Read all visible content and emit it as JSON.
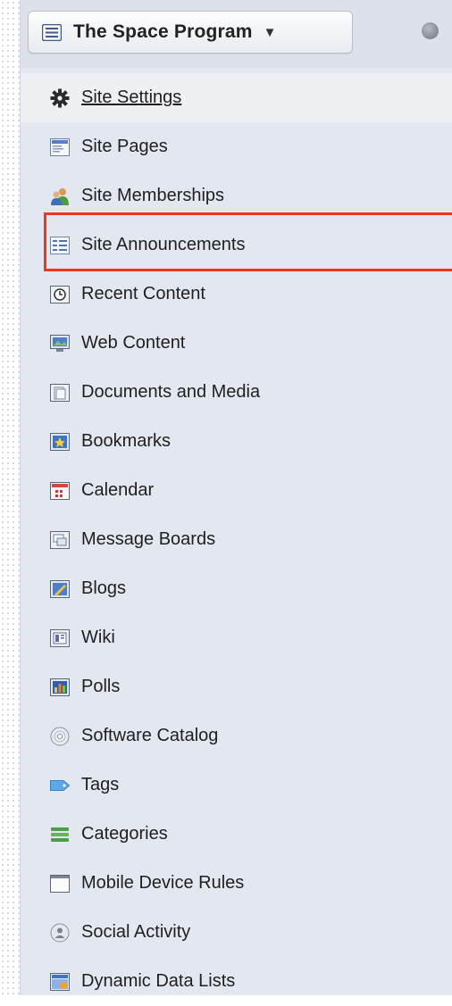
{
  "header": {
    "site_name": "The Space Program",
    "caret": "▼"
  },
  "menu": {
    "items": [
      {
        "label": "Site Settings",
        "icon": "gear-icon"
      },
      {
        "label": "Site Pages",
        "icon": "pages-icon"
      },
      {
        "label": "Site Memberships",
        "icon": "users-icon"
      },
      {
        "label": "Site Announcements",
        "icon": "announcements-icon"
      },
      {
        "label": "Recent Content",
        "icon": "clock-icon"
      },
      {
        "label": "Web Content",
        "icon": "web-content-icon"
      },
      {
        "label": "Documents and Media",
        "icon": "documents-icon"
      },
      {
        "label": "Bookmarks",
        "icon": "bookmark-icon"
      },
      {
        "label": "Calendar",
        "icon": "calendar-icon"
      },
      {
        "label": "Message Boards",
        "icon": "message-boards-icon"
      },
      {
        "label": "Blogs",
        "icon": "blogs-icon"
      },
      {
        "label": "Wiki",
        "icon": "wiki-icon"
      },
      {
        "label": "Polls",
        "icon": "polls-icon"
      },
      {
        "label": "Software Catalog",
        "icon": "disc-icon"
      },
      {
        "label": "Tags",
        "icon": "tag-icon"
      },
      {
        "label": "Categories",
        "icon": "categories-icon"
      },
      {
        "label": "Mobile Device Rules",
        "icon": "mobile-rules-icon"
      },
      {
        "label": "Social Activity",
        "icon": "social-icon"
      },
      {
        "label": "Dynamic Data Lists",
        "icon": "data-lists-icon"
      }
    ]
  },
  "colors": {
    "panel_bg": "#e3e7ef",
    "highlight_border": "#f2341c",
    "text": "#1f1f1f"
  }
}
